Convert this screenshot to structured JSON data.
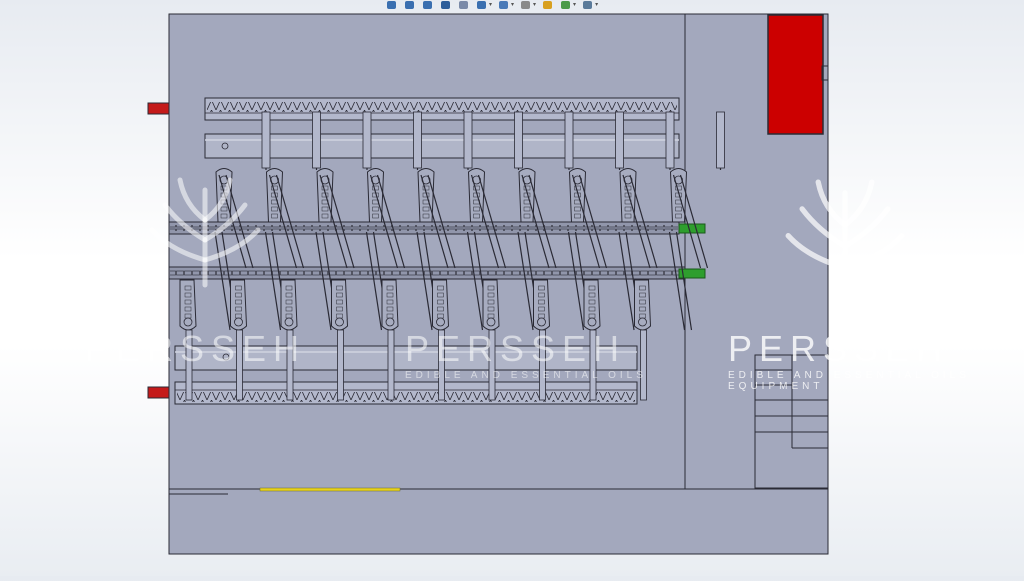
{
  "toolbar": {
    "buttons": [
      {
        "icon": "zoom-to-fit-icon",
        "dropdown": false
      },
      {
        "icon": "zoom-to-area-icon",
        "dropdown": false
      },
      {
        "icon": "previous-view-icon",
        "dropdown": false
      },
      {
        "icon": "section-view-icon",
        "dropdown": false
      },
      {
        "icon": "dynamic-annotation-icon",
        "dropdown": false
      },
      {
        "icon": "view-orientation-icon",
        "dropdown": true
      },
      {
        "icon": "display-style-icon",
        "dropdown": true
      },
      {
        "icon": "hide-show-items-icon",
        "dropdown": true
      },
      {
        "icon": "edit-appearance-icon",
        "dropdown": false
      },
      {
        "icon": "apply-scene-icon",
        "dropdown": true
      },
      {
        "icon": "view-settings-icon",
        "dropdown": true
      }
    ]
  },
  "watermark": {
    "brand": "PERSSEH",
    "tagline_1": "EDIBLE AND ESSENTIAL OILS",
    "tagline_2": "EQUIPMENT"
  },
  "colors": {
    "floor": "#a3a8bd",
    "tank": "#cc0000",
    "pipe_outlet": "#c41a1a",
    "motor_fitting": "#2e9e2e",
    "yellow_line": "#e8d21a",
    "outline": "#2a2a35"
  }
}
